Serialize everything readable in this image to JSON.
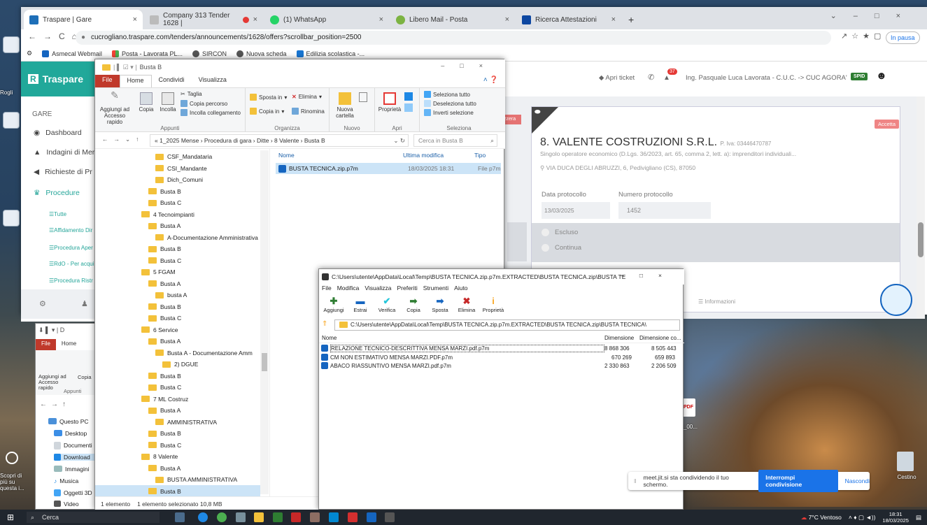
{
  "browser": {
    "tabs": [
      {
        "label": "Traspare | Gare",
        "icon": "traspare-icon",
        "active": true
      },
      {
        "label": "Company 313 Tender 1628 |",
        "icon": "pin-icon"
      },
      {
        "label": "(1) WhatsApp",
        "icon": "whatsapp-icon"
      },
      {
        "label": "Libero Mail - Posta",
        "icon": "libero-icon"
      },
      {
        "label": "Ricerca Attestazioni",
        "icon": "anac-icon"
      }
    ],
    "url": "cucrogliano.traspare.com/tenders/announcements/1628/offers?scrollbar_position=2500",
    "profile_status": "In pausa",
    "bookmarks": [
      "Asmecal Webmail",
      "Posta - Lavorata PL...",
      "SIRCON",
      "Nuova scheda",
      "Edilizia scolastica -..."
    ]
  },
  "app": {
    "brand": "Traspare",
    "section": "GARE",
    "nav": [
      "Dashboard",
      "Indagini di Mer",
      "Richieste di Pr",
      "Procedure"
    ],
    "subnav": [
      "Tutte",
      "Affidamento Dir",
      "Procedura Aper",
      "RdO - Per acqui",
      "Procedura Ristr"
    ],
    "topbar": {
      "ticket": "Apri ticket",
      "notifications": "37",
      "user": "Ing. Pasquale Luca Lavorata - C.U.C. -> CUC AGORA'",
      "spid": "SPID"
    },
    "left_button": "zzera",
    "accept_button": "Accetta",
    "card": {
      "title": "8. VALENTE COSTRUZIONI S.R.L.",
      "vat": "P. Iva: 03446470787",
      "type": "Singolo operatore economico (D.Lgs. 36/2023, art. 65, comma 2, lett. a): imprenditori individuali...",
      "address": "VIA DUCA DEGLI ABRUZZI, 6, Pedivigliano (CS), 87050",
      "date_label": "Data protocollo",
      "date_value": "13/03/2025",
      "num_label": "Numero protocollo",
      "num_value": "1452",
      "options": [
        "Escluso",
        "Continua"
      ],
      "info": "Informazioni"
    }
  },
  "explorer": {
    "title": "Busta B",
    "ribbon_tabs": [
      "File",
      "Home",
      "Condividi",
      "Visualizza"
    ],
    "groups": {
      "appunti": {
        "label": "Appunti",
        "pin": "Aggiungi ad Accesso rapido",
        "copy": "Copia",
        "paste": "Incolla",
        "cut": "Taglia",
        "copy_path": "Copia percorso",
        "paste_link": "Incolla collegamento"
      },
      "organizza": {
        "label": "Organizza",
        "move": "Sposta in",
        "delete": "Elimina",
        "copy_to": "Copia in",
        "rename": "Rinomina"
      },
      "nuovo": {
        "label": "Nuovo",
        "new_folder": "Nuova cartella"
      },
      "apri": {
        "label": "Apri",
        "props": "Proprietà"
      },
      "seleziona": {
        "label": "Seleziona",
        "all": "Seleziona tutto",
        "none": "Deseleziona tutto",
        "invert": "Inverti selezione"
      }
    },
    "path": "« 1_2025 Mense › Procedura di gara › Ditte › 8 Valente › Busta B",
    "search": "Cerca in Busta B",
    "tree": [
      {
        "label": "CSF_Mandataria",
        "indent": 2
      },
      {
        "label": "CSI_Mandante",
        "indent": 2
      },
      {
        "label": "Dich_Comuni",
        "indent": 2
      },
      {
        "label": "Busta B",
        "indent": 1
      },
      {
        "label": "Busta C",
        "indent": 1
      },
      {
        "label": "4 Tecnoimpianti",
        "indent": 0
      },
      {
        "label": "Busta A",
        "indent": 1
      },
      {
        "label": "A-Documentazione Amministrativa",
        "indent": 2
      },
      {
        "label": "Busta B",
        "indent": 1
      },
      {
        "label": "Busta C",
        "indent": 1
      },
      {
        "label": "5 FGAM",
        "indent": 0
      },
      {
        "label": "Busta A",
        "indent": 1
      },
      {
        "label": "busta A",
        "indent": 2
      },
      {
        "label": "Busta B",
        "indent": 1
      },
      {
        "label": "Busta C",
        "indent": 1
      },
      {
        "label": "6 Service",
        "indent": 0
      },
      {
        "label": "Busta A",
        "indent": 1
      },
      {
        "label": "Busta A - Documentazione Amm",
        "indent": 2
      },
      {
        "label": "2) DGUE",
        "indent": 3
      },
      {
        "label": "Busta B",
        "indent": 1
      },
      {
        "label": "Busta C",
        "indent": 1
      },
      {
        "label": "7 ML Costruz",
        "indent": 0
      },
      {
        "label": "Busta A",
        "indent": 1
      },
      {
        "label": "AMMINISTRATIVA",
        "indent": 2
      },
      {
        "label": "Busta B",
        "indent": 1
      },
      {
        "label": "Busta C",
        "indent": 1
      },
      {
        "label": "8 Valente",
        "indent": 0
      },
      {
        "label": "Busta A",
        "indent": 1
      },
      {
        "label": "BUSTA AMMINISTRATIVA",
        "indent": 2
      },
      {
        "label": "Busta B",
        "indent": 1,
        "selected": true
      }
    ],
    "columns": [
      "Nome",
      "Ultima modifica",
      "Tipo"
    ],
    "files": [
      {
        "name": "BUSTA TECNICA.zip.p7m",
        "date": "18/03/2025 18:31",
        "type": "File p7m"
      }
    ],
    "status": [
      "1 elemento",
      "1 elemento selezionato 10,8 MB"
    ]
  },
  "explorer2": {
    "tabs": [
      "File",
      "Home"
    ],
    "pin": "Aggiungi ad Accesso rapido",
    "copy": "Copia",
    "appunti": "Appunti",
    "nav": [
      "Questo PC",
      "Desktop",
      "Documenti",
      "Download",
      "Immagini",
      "Musica",
      "Oggetti 3D",
      "Video"
    ]
  },
  "zip": {
    "title": "C:\\Users\\utente\\AppData\\Local\\Temp\\BUSTA TECNICA.zip.p7m.EXTRACTED\\BUSTA TECNICA.zip\\BUSTA TEC...",
    "menu": [
      "File",
      "Modifica",
      "Visualizza",
      "Preferiti",
      "Strumenti",
      "Aiuto"
    ],
    "tools": [
      "Aggiungi",
      "Estrai",
      "Verifica",
      "Copia",
      "Sposta",
      "Elimina",
      "Proprietà"
    ],
    "path": "C:\\Users\\utente\\AppData\\Local\\Temp\\BUSTA TECNICA.zip.p7m.EXTRACTED\\BUSTA TECNICA.zip\\BUSTA TECNICA\\",
    "columns": [
      "Nome",
      "Dimensione",
      "Dimensione co..."
    ],
    "rows": [
      {
        "name": "RELAZIONE TECNICO-DESCRITTIVA MENSA MARZI.pdf.p7m",
        "size": "8 868 306",
        "packed": "8 505 443"
      },
      {
        "name": "CM NON ESTIMATIVO MENSA MARZI.PDF.p7m",
        "size": "670 269",
        "packed": "659 893"
      },
      {
        "name": "ABACO RIASSUNTIVO MENSA MARZI.pdf.p7m",
        "size": "2 330 863",
        "packed": "2 206 509"
      }
    ]
  },
  "meet": {
    "text": "meet.jit.si sta condividendo il tuo schermo.",
    "stop": "Interrompi condivisione",
    "hide": "Nascondi"
  },
  "desktop": {
    "left_labels": [
      "Rogli",
      "Scopri di più su questa i..."
    ],
    "recycle_bin": "Cestino",
    "pdf_label": "_3_00..."
  },
  "taskbar": {
    "search": "Cerca",
    "weather": "7°C Ventoso",
    "time": "18:31",
    "date": "18/03/2025"
  }
}
